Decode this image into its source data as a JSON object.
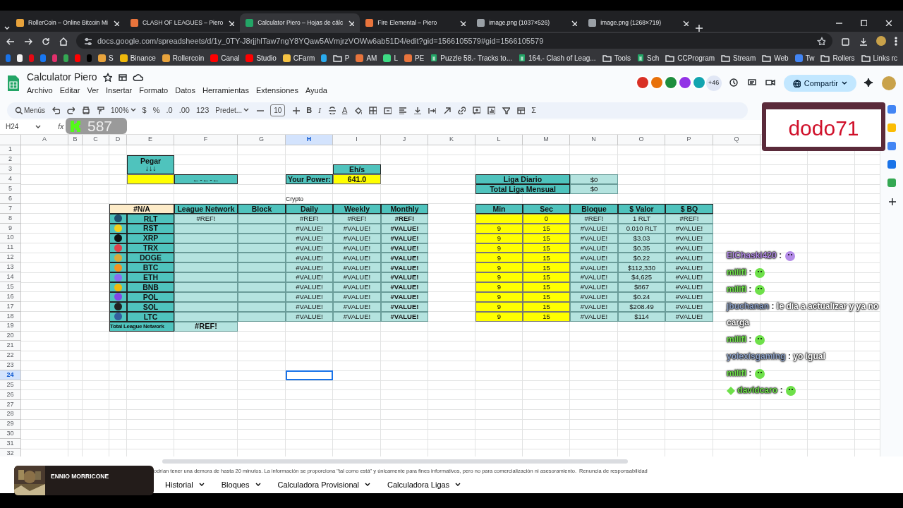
{
  "browser": {
    "tabs": [
      {
        "title": "RollerCoin – Online Bitcoin Mi",
        "color": "#e8a33c",
        "selected": false
      },
      {
        "title": "CLASH OF LEAGUES – Piero",
        "color": "#e8743c",
        "selected": false
      },
      {
        "title": "Calculator Piero – Hojas de cálc",
        "color": "#23a566",
        "selected": true
      },
      {
        "title": "Fire Elemental – Piero",
        "color": "#e8743c",
        "selected": false
      },
      {
        "title": "image.png (1037×526)",
        "color": "#9aa0a6",
        "selected": false
      },
      {
        "title": "image.png (1268×719)",
        "color": "#9aa0a6",
        "selected": false
      }
    ],
    "url": "docs.google.com/spreadsheets/d/1y_0TY-J8rjjhlTaw7ngY8YQaw5AVmjrzVOWw6ab51D4/edit?gid=1566105579#gid=1566105579",
    "bookmarks": [
      {
        "kind": "site",
        "color": "#1a73e8"
      },
      {
        "kind": "site",
        "color": "#f1f1f1"
      },
      {
        "kind": "site",
        "color": "#e50914"
      },
      {
        "kind": "site",
        "color": "#1877f2"
      },
      {
        "kind": "site",
        "color": "#e1306c"
      },
      {
        "kind": "site",
        "color": "#34a853"
      },
      {
        "kind": "site",
        "color": "#ff0000"
      },
      {
        "kind": "site",
        "color": "#000000"
      },
      {
        "kind": "site",
        "color": "#e8a33c",
        "label": "S"
      },
      {
        "kind": "site",
        "color": "#f0b90b",
        "label": "Binance"
      },
      {
        "kind": "site",
        "color": "#e8a33c",
        "label": "Rollercoin"
      },
      {
        "kind": "site",
        "color": "#ff0000",
        "label": "Canal"
      },
      {
        "kind": "site",
        "color": "#ff0000",
        "label": "Studio"
      },
      {
        "kind": "site",
        "color": "#f6c343",
        "label": "CFarm"
      },
      {
        "kind": "site",
        "color": "#2aabee"
      },
      {
        "kind": "folder",
        "label": "P"
      },
      {
        "kind": "site",
        "color": "#e8743c",
        "label": "AM"
      },
      {
        "kind": "site",
        "color": "#3ddc84",
        "label": "L"
      },
      {
        "kind": "site",
        "color": "#e8743c",
        "label": "PE"
      },
      {
        "kind": "sheet",
        "label": "Puzzle 58.- Tracks to..."
      },
      {
        "kind": "sheet",
        "label": "164.- Clash of Leag..."
      },
      {
        "kind": "folder",
        "label": "Tools"
      },
      {
        "kind": "sheet",
        "label": "Sch"
      },
      {
        "kind": "folder",
        "label": "CCProgram"
      },
      {
        "kind": "folder",
        "label": "Stream"
      },
      {
        "kind": "folder",
        "label": "Web"
      },
      {
        "kind": "site",
        "color": "#4285f4",
        "label": "Tw"
      },
      {
        "kind": "folder",
        "label": "Rollers"
      },
      {
        "kind": "folder",
        "label": "Links rc"
      }
    ]
  },
  "doc": {
    "title": "Calculator Piero",
    "menus": [
      "Archivo",
      "Editar",
      "Ver",
      "Insertar",
      "Formato",
      "Datos",
      "Herramientas",
      "Extensiones",
      "Ayuda"
    ],
    "collaborators": [
      {
        "color": "#d93025"
      },
      {
        "color": "#e8710a"
      },
      {
        "color": "#1e8e3e"
      },
      {
        "color": "#9334e6"
      },
      {
        "color": "#12a4af"
      }
    ],
    "more_collaborators": "+46",
    "share": "Compartir"
  },
  "toolbar": [
    {
      "kind": "search",
      "label": "Menús"
    },
    {
      "kind": "undo"
    },
    {
      "kind": "redo"
    },
    {
      "kind": "print"
    },
    {
      "kind": "paint"
    },
    {
      "kind": "dropdown",
      "label": "100%"
    },
    {
      "kind": "text",
      "label": "$"
    },
    {
      "kind": "text",
      "label": "%"
    },
    {
      "kind": "text",
      "label": ".0"
    },
    {
      "kind": "text",
      "label": ".00"
    },
    {
      "kind": "text",
      "label": "123"
    },
    {
      "kind": "dropdown",
      "label": "Predet..."
    },
    {
      "kind": "minus"
    },
    {
      "kind": "size",
      "label": "10"
    },
    {
      "kind": "plus"
    },
    {
      "kind": "bold",
      "label": "B"
    },
    {
      "kind": "italic",
      "label": "I"
    },
    {
      "kind": "strike"
    },
    {
      "kind": "color",
      "label": "A"
    },
    {
      "kind": "fill"
    },
    {
      "kind": "borders"
    },
    {
      "kind": "merge"
    },
    {
      "kind": "align"
    },
    {
      "kind": "valign"
    },
    {
      "kind": "wrap"
    },
    {
      "kind": "rotate"
    },
    {
      "kind": "link"
    },
    {
      "kind": "comment"
    },
    {
      "kind": "chart"
    },
    {
      "kind": "filter"
    },
    {
      "kind": "view"
    },
    {
      "kind": "text",
      "label": "Σ"
    }
  ],
  "name_box": "H24",
  "formula_label": "fx",
  "sheet": {
    "columns": [
      {
        "label": "A",
        "selected": false
      },
      {
        "label": "B",
        "selected": false
      },
      {
        "label": "C",
        "selected": false
      },
      {
        "label": "D",
        "selected": false
      },
      {
        "label": "E",
        "selected": false
      },
      {
        "label": "F",
        "selected": false
      },
      {
        "label": "G",
        "selected": false
      },
      {
        "label": "H",
        "selected": true
      },
      {
        "label": "I",
        "selected": false
      },
      {
        "label": "J",
        "selected": false
      },
      {
        "label": "K",
        "selected": false
      },
      {
        "label": "L",
        "selected": false
      },
      {
        "label": "M",
        "selected": false
      },
      {
        "label": "N",
        "selected": false
      },
      {
        "label": "O",
        "selected": false
      },
      {
        "label": "P",
        "selected": false
      },
      {
        "label": "Q",
        "selected": false
      }
    ],
    "rows": [
      {
        "label": "1",
        "selected": false
      },
      {
        "label": "2",
        "selected": false
      },
      {
        "label": "3",
        "selected": false
      },
      {
        "label": "4",
        "selected": false
      },
      {
        "label": "5",
        "selected": false
      },
      {
        "label": "6",
        "selected": false
      },
      {
        "label": "7",
        "selected": false
      },
      {
        "label": "8",
        "selected": false
      },
      {
        "label": "9",
        "selected": false
      },
      {
        "label": "10",
        "selected": false
      },
      {
        "label": "11",
        "selected": false
      },
      {
        "label": "12",
        "selected": false
      },
      {
        "label": "13",
        "selected": false
      },
      {
        "label": "14",
        "selected": false
      },
      {
        "label": "15",
        "selected": false
      },
      {
        "label": "16",
        "selected": false
      },
      {
        "label": "17",
        "selected": false
      },
      {
        "label": "18",
        "selected": false
      },
      {
        "label": "19",
        "selected": false
      },
      {
        "label": "20",
        "selected": false
      },
      {
        "label": "21",
        "selected": false
      },
      {
        "label": "22",
        "selected": false
      },
      {
        "label": "23",
        "selected": false
      },
      {
        "label": "24",
        "selected": true
      },
      {
        "label": "25",
        "selected": false
      },
      {
        "label": "26",
        "selected": false
      },
      {
        "label": "27",
        "selected": false
      },
      {
        "label": "28",
        "selected": false
      },
      {
        "label": "29",
        "selected": false
      },
      {
        "label": "30",
        "selected": false
      },
      {
        "label": "31",
        "selected": false
      },
      {
        "label": "32",
        "selected": false
      }
    ],
    "pegar": {
      "label": "Pegar",
      "arrows": "↓↓↓",
      "arrow_cell": "←-←-←"
    },
    "power": {
      "unit": "Eh/s",
      "label": "Your Power:",
      "value": "641.0"
    },
    "note": "Crypto",
    "league_table": {
      "corner": "#N/A",
      "columns": [
        "League Network",
        "Block",
        "Daily",
        "Weekly",
        "Monthly"
      ],
      "rows": [
        {
          "coin": "RLT",
          "color": "#1f4e6e",
          "league_network": "#REF!",
          "daily": "#REF!",
          "weekly": "#REF!",
          "monthly": "#REF!"
        },
        {
          "coin": "RST",
          "color": "#f2d01e",
          "daily": "#VALUE!",
          "weekly": "#VALUE!",
          "monthly": "#VALUE!"
        },
        {
          "coin": "XRP",
          "color": "#111111",
          "daily": "#VALUE!",
          "weekly": "#VALUE!",
          "monthly": "#VALUE!"
        },
        {
          "coin": "TRX",
          "color": "#e0424b",
          "daily": "#VALUE!",
          "weekly": "#VALUE!",
          "monthly": "#VALUE!"
        },
        {
          "coin": "DOGE",
          "color": "#d9a93b",
          "daily": "#VALUE!",
          "weekly": "#VALUE!",
          "monthly": "#VALUE!"
        },
        {
          "coin": "BTC",
          "color": "#f39321",
          "daily": "#VALUE!",
          "weekly": "#VALUE!",
          "monthly": "#VALUE!"
        },
        {
          "coin": "ETH",
          "color": "#8a6cf0",
          "daily": "#VALUE!",
          "weekly": "#VALUE!",
          "monthly": "#VALUE!"
        },
        {
          "coin": "BNB",
          "color": "#f0b90b",
          "daily": "#VALUE!",
          "weekly": "#VALUE!",
          "monthly": "#VALUE!"
        },
        {
          "coin": "POL",
          "color": "#8247e5",
          "daily": "#VALUE!",
          "weekly": "#VALUE!",
          "monthly": "#VALUE!"
        },
        {
          "coin": "SOL",
          "color": "#222222",
          "daily": "#VALUE!",
          "weekly": "#VALUE!",
          "monthly": "#VALUE!"
        },
        {
          "coin": "LTC",
          "color": "#345d9d",
          "daily": "#VALUE!",
          "weekly": "#VALUE!",
          "monthly": "#VALUE!"
        }
      ],
      "total_label": "Total League Network",
      "total": "#REF!"
    },
    "liga": [
      {
        "label": "Liga Diario",
        "value": "$0"
      },
      {
        "label": "Total Liga Mensual",
        "value": "$0"
      }
    ],
    "block_table": {
      "columns": [
        "Min",
        "Sec",
        "Bloque",
        "$ Valor",
        "$ BQ"
      ],
      "rows": [
        {
          "sec": "0",
          "bloque": "#REF!",
          "valor": "1 RLT",
          "bq": "#REF!"
        },
        {
          "min": "9",
          "sec": "15",
          "bloque": "#VALUE!",
          "valor": "0.010 RLT",
          "bq": "#VALUE!"
        },
        {
          "min": "9",
          "sec": "15",
          "bloque": "#VALUE!",
          "valor": "$3.03",
          "bq": "#VALUE!"
        },
        {
          "min": "9",
          "sec": "15",
          "bloque": "#VALUE!",
          "valor": "$0.35",
          "bq": "#VALUE!"
        },
        {
          "min": "9",
          "sec": "15",
          "bloque": "#VALUE!",
          "valor": "$0.22",
          "bq": "#VALUE!"
        },
        {
          "min": "9",
          "sec": "15",
          "bloque": "#VALUE!",
          "valor": "$112,330",
          "bq": "#VALUE!"
        },
        {
          "min": "9",
          "sec": "15",
          "bloque": "#VALUE!",
          "valor": "$4,625",
          "bq": "#VALUE!"
        },
        {
          "min": "9",
          "sec": "15",
          "bloque": "#VALUE!",
          "valor": "$867",
          "bq": "#VALUE!"
        },
        {
          "min": "9",
          "sec": "15",
          "bloque": "#VALUE!",
          "valor": "$0.24",
          "bq": "#VALUE!"
        },
        {
          "min": "9",
          "sec": "15",
          "bloque": "#VALUE!",
          "valor": "$208.49",
          "bq": "#VALUE!"
        },
        {
          "min": "9",
          "sec": "15",
          "bloque": "#VALUE!",
          "valor": "$114",
          "bq": "#VALUE!"
        }
      ]
    }
  },
  "disclaimer": "odrían tener una demora de hasta 20 minutos. La información se proporciona \"tal como está\" y únicamente para fines informativos, pero no para comercialización ni asesoramiento.",
  "disclaimer_link": "Renuncia de responsabilidad",
  "sheet_tabs": [
    {
      "label": "Historial",
      "selected": false
    },
    {
      "label": "Bloques",
      "selected": false
    },
    {
      "label": "Calculadora Provisional",
      "selected": false
    },
    {
      "label": "Calculadora Ligas",
      "selected": false
    }
  ],
  "stream": {
    "viewer_count": "587",
    "streamer": "dodo71",
    "now_playing": "ENNIO MORRICONE",
    "chat": [
      {
        "user": "ElChaski420",
        "color": "#b48ce8",
        "separator": ":",
        "emote": true
      },
      {
        "user": "milifl",
        "color": "#6ee04a",
        "separator": ":",
        "emote": true
      },
      {
        "user": "milifl",
        "color": "#6ee04a",
        "separator": ":",
        "emote": true
      },
      {
        "user": "jbuchanan",
        "color": "#8fa3c8",
        "separator": ":",
        "text": "le dia a actualizar y ya no carga"
      },
      {
        "user": "milifl",
        "color": "#6ee04a",
        "separator": ":",
        "emote": true
      },
      {
        "user": "yolexisgaming",
        "color": "#8fa3c8",
        "separator": ":",
        "text": "yo igual"
      },
      {
        "user": "milifl",
        "color": "#6ee04a",
        "separator": ":",
        "emote": true
      },
      {
        "user": "davidcaro",
        "color": "#6ee04a",
        "separator": ":",
        "badge": true,
        "emote": true
      }
    ]
  }
}
